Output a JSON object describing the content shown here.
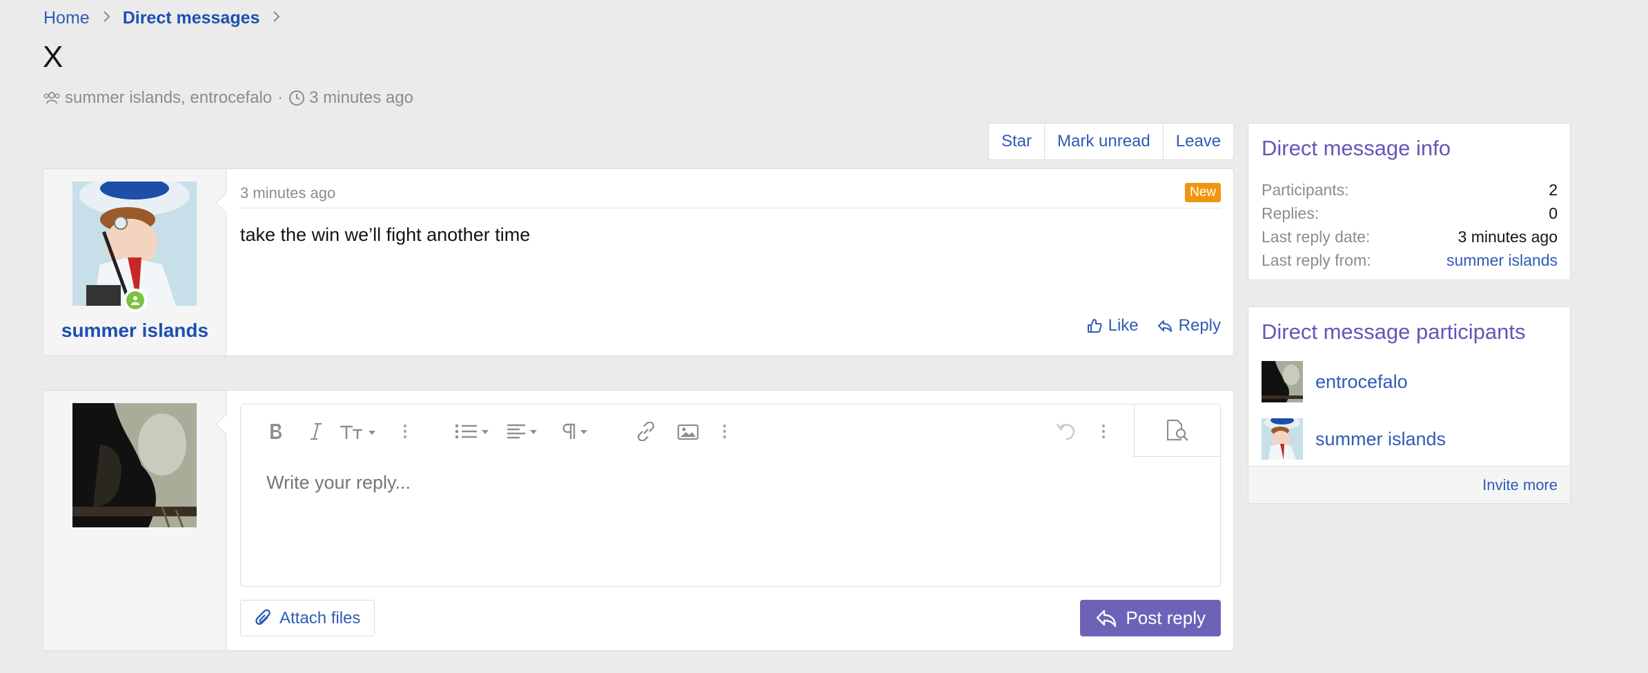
{
  "breadcrumb": {
    "home": "Home",
    "section": "Direct messages"
  },
  "title": "X",
  "meta": {
    "participants": "summer islands, entrocefalo",
    "separator": "·",
    "time": "3 minutes ago"
  },
  "actions": {
    "star": "Star",
    "mark_unread": "Mark unread",
    "leave": "Leave"
  },
  "message": {
    "author": "summer islands",
    "date": "3 minutes ago",
    "badge": "New",
    "body": "take the win we’ll fight another time",
    "like": "Like",
    "reply": "Reply"
  },
  "reply_box": {
    "placeholder": "Write your reply...",
    "attach": "Attach files",
    "post": "Post reply"
  },
  "info": {
    "title": "Direct message info",
    "rows": [
      {
        "label": "Participants:",
        "value": "2"
      },
      {
        "label": "Replies:",
        "value": "0"
      },
      {
        "label": "Last reply date:",
        "value": "3 minutes ago"
      },
      {
        "label": "Last reply from:",
        "value": "summer islands"
      }
    ]
  },
  "participants": {
    "title": "Direct message participants",
    "list": [
      {
        "name": "entrocefalo"
      },
      {
        "name": "summer islands"
      }
    ],
    "invite": "Invite more"
  },
  "colors": {
    "link": "#2f5bb7",
    "accent": "#6157b8",
    "button": "#6c63b8",
    "badge": "#f0960e",
    "online": "#7bc240"
  },
  "icons": [
    "chevron-right-icon",
    "users-icon",
    "clock-icon",
    "thumbs-up-icon",
    "reply-icon",
    "bold-icon",
    "italic-icon",
    "text-size-icon",
    "more-icon",
    "list-icon",
    "align-icon",
    "paragraph-icon",
    "link-icon",
    "image-icon",
    "undo-icon",
    "preview-icon",
    "paperclip-icon"
  ]
}
